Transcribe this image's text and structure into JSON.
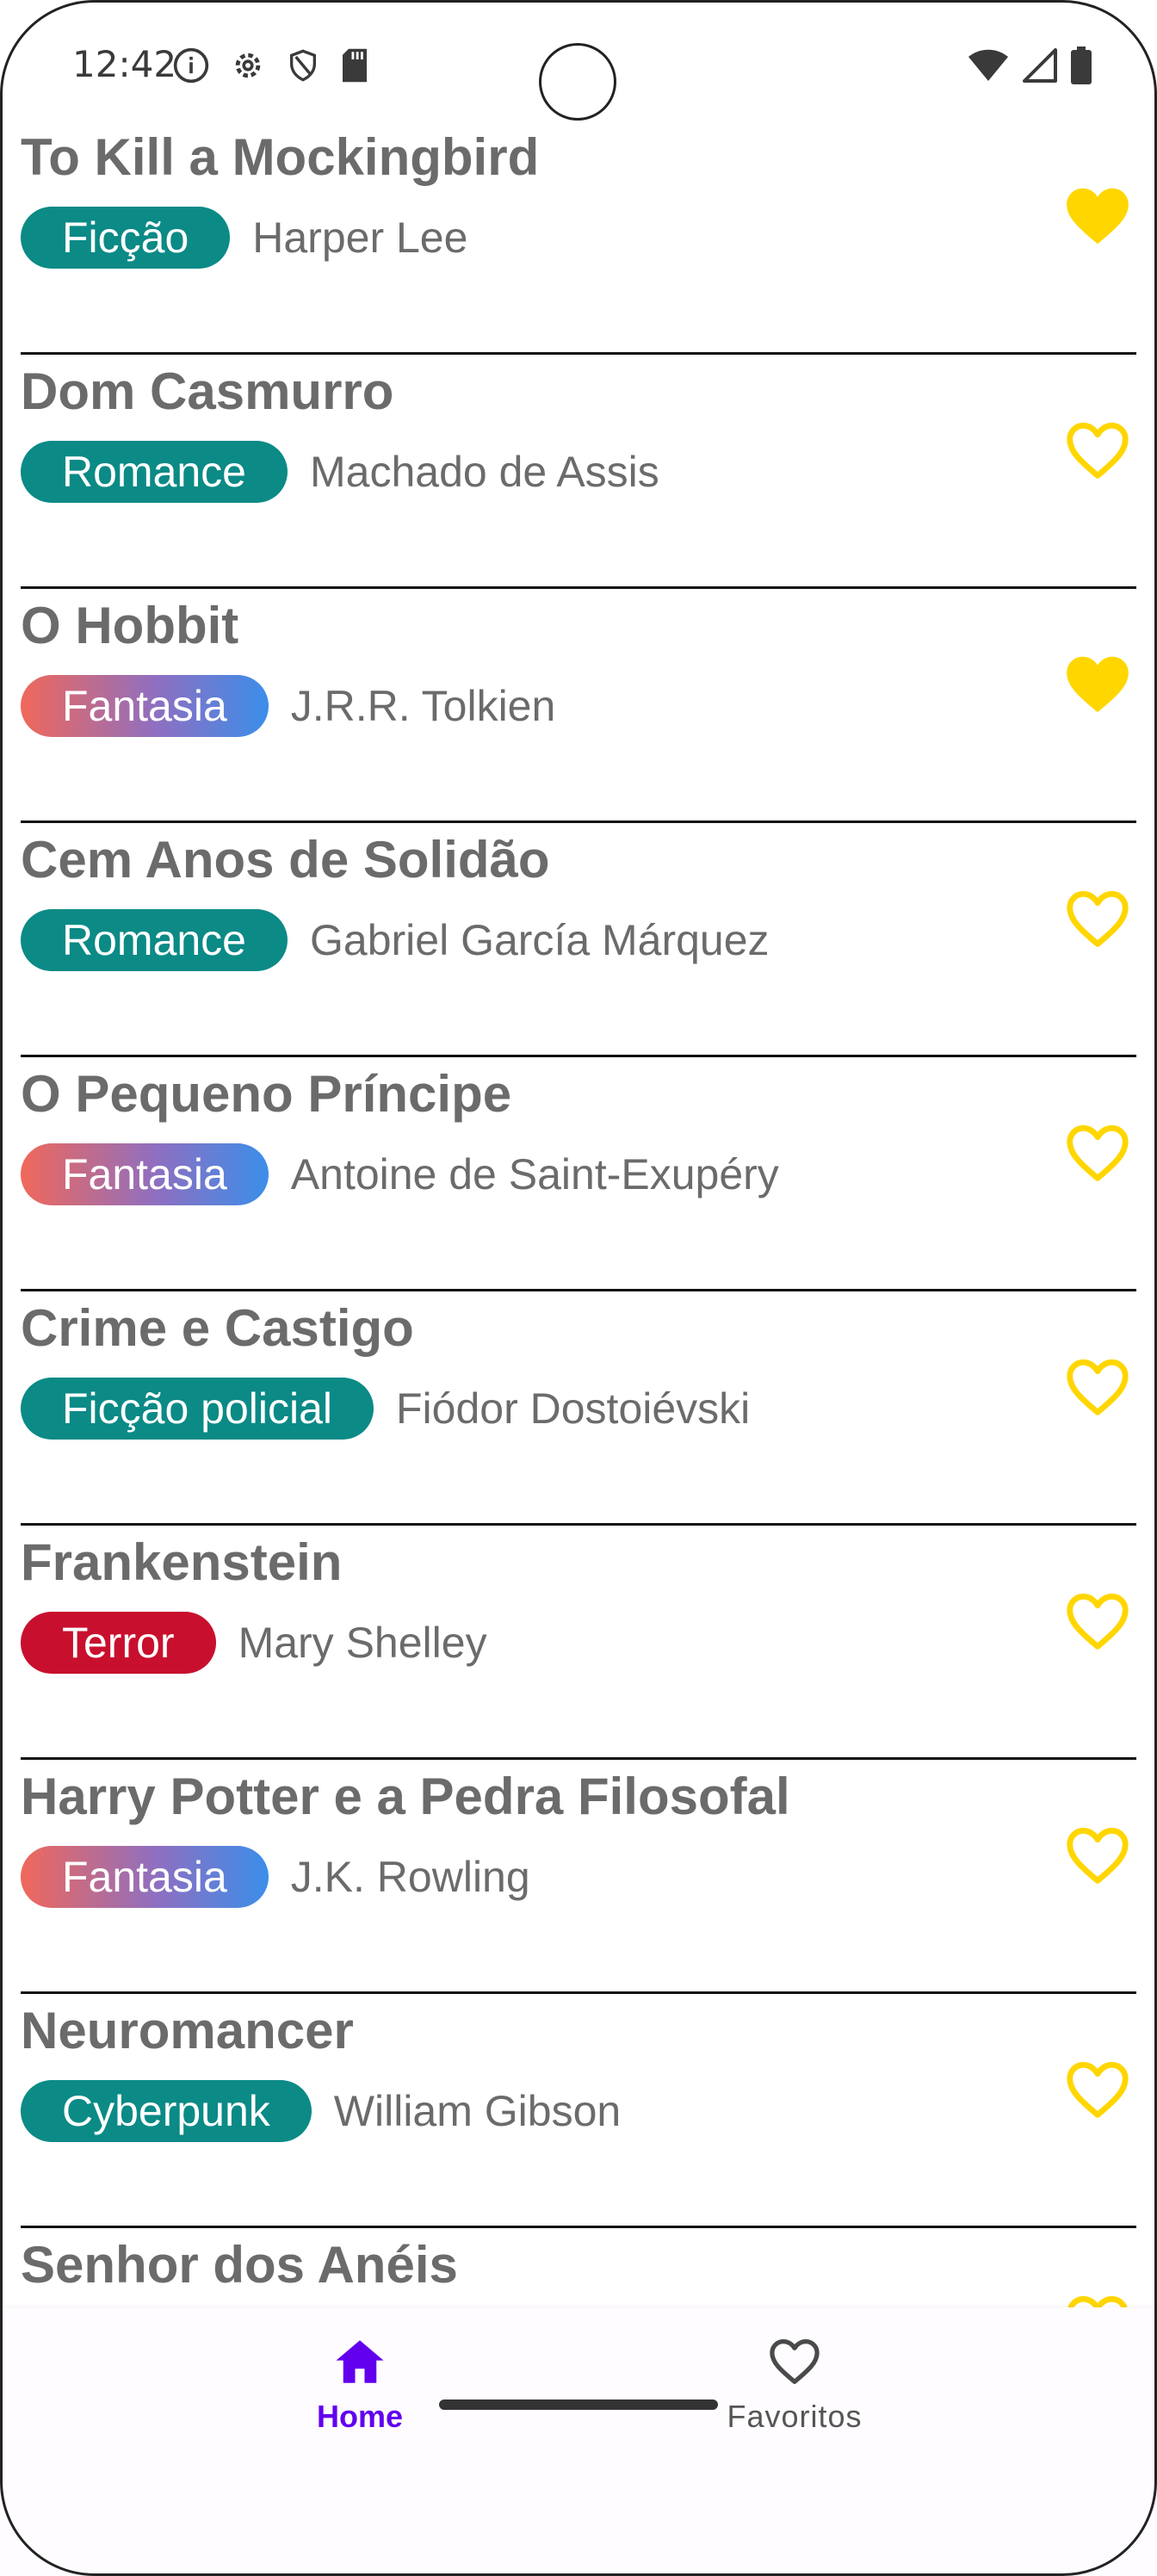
{
  "status_bar": {
    "time": "12:42",
    "left_icons": [
      "info-icon",
      "settings-gear-icon",
      "shield-icon",
      "sd-card-icon"
    ],
    "right_icons": [
      "wifi-icon",
      "cellular-signal-icon",
      "battery-icon"
    ]
  },
  "colors": {
    "title_gray": "#6b6b6b",
    "chip_teal": "#0b8a86",
    "chip_red": "#c8102e",
    "heart_yellow": "#ffd600",
    "nav_active": "#6200ee"
  },
  "books": [
    {
      "title": "To Kill a Mockingbird",
      "genre": "Ficção",
      "genre_style": "teal",
      "author": "Harper Lee",
      "favorite": true
    },
    {
      "title": "Dom Casmurro",
      "genre": "Romance",
      "genre_style": "teal",
      "author": "Machado de Assis",
      "favorite": false
    },
    {
      "title": "O Hobbit",
      "genre": "Fantasia",
      "genre_style": "gradient",
      "author": "J.R.R. Tolkien",
      "favorite": true
    },
    {
      "title": "Cem Anos de Solidão",
      "genre": "Romance",
      "genre_style": "teal",
      "author": "Gabriel García Márquez",
      "favorite": false
    },
    {
      "title": "O Pequeno Príncipe",
      "genre": "Fantasia",
      "genre_style": "gradient",
      "author": "Antoine de Saint-Exupéry",
      "favorite": false
    },
    {
      "title": "Crime e Castigo",
      "genre": "Ficção policial",
      "genre_style": "teal",
      "author": "Fiódor Dostoiévski",
      "favorite": false
    },
    {
      "title": "Frankenstein",
      "genre": "Terror",
      "genre_style": "red",
      "author": "Mary Shelley",
      "favorite": false
    },
    {
      "title": "Harry Potter e a Pedra Filosofal",
      "genre": "Fantasia",
      "genre_style": "gradient",
      "author": "J.K. Rowling",
      "favorite": false
    },
    {
      "title": "Neuromancer",
      "genre": "Cyberpunk",
      "genre_style": "teal",
      "author": "William Gibson",
      "favorite": false
    },
    {
      "title": "Senhor dos Anéis",
      "genre": "",
      "genre_style": "",
      "author": "",
      "favorite": false
    }
  ],
  "bottom_nav": {
    "items": [
      {
        "label": "Home",
        "icon": "home-icon",
        "active": true
      },
      {
        "label": "Favoritos",
        "icon": "heart-outline-icon",
        "active": false
      }
    ]
  }
}
